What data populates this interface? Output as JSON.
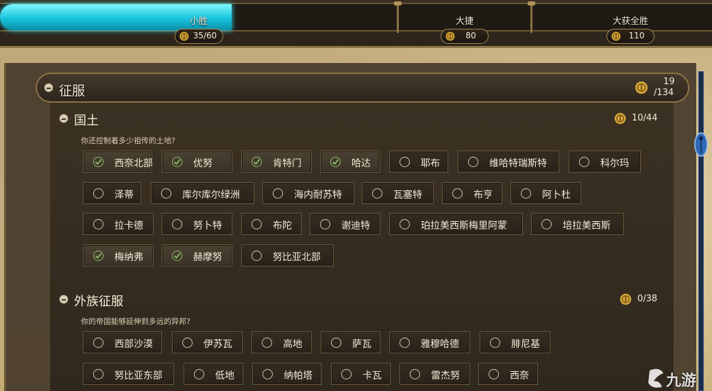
{
  "progress": {
    "value_fraction": 0.325,
    "tiers": [
      {
        "label": "小胜",
        "badge": "35/60"
      },
      {
        "label": "大捷",
        "badge": "80"
      },
      {
        "label": "大获全胜",
        "badge": "110"
      }
    ]
  },
  "conquest": {
    "title": "征服",
    "count_top": "19",
    "count_bottom": "/134"
  },
  "territory": {
    "title": "国土",
    "desc": "你还控制着多少祖传的土地?",
    "count": "10/44",
    "items": [
      {
        "label": "西奈北部",
        "checked": true
      },
      {
        "label": "优努",
        "checked": true
      },
      {
        "label": "肯特门",
        "checked": true
      },
      {
        "label": "哈达",
        "checked": true
      },
      {
        "label": "耶布",
        "checked": false
      },
      {
        "label": "维哈特瑞斯特",
        "checked": false
      },
      {
        "label": "科尔玛",
        "checked": false
      },
      {
        "label": "泽蒂",
        "checked": false
      },
      {
        "label": "库尔库尔绿洲",
        "checked": false
      },
      {
        "label": "海内耐苏特",
        "checked": false
      },
      {
        "label": "瓦塞特",
        "checked": false
      },
      {
        "label": "布亨",
        "checked": false
      },
      {
        "label": "阿卜杜",
        "checked": false
      },
      {
        "label": "拉卡德",
        "checked": false
      },
      {
        "label": "努卜特",
        "checked": false
      },
      {
        "label": "布陀",
        "checked": false
      },
      {
        "label": "谢迪特",
        "checked": false
      },
      {
        "label": "珀拉美西斯梅里阿蒙",
        "checked": false
      },
      {
        "label": "培拉美西斯",
        "checked": false
      },
      {
        "label": "梅纳弗",
        "checked": true
      },
      {
        "label": "赫摩努",
        "checked": true
      },
      {
        "label": "努比亚北部",
        "checked": false
      }
    ]
  },
  "foreign": {
    "title": "外族征服",
    "desc": "你的帝国能够延伸到多远的异邦?",
    "count": "0/38",
    "items": [
      {
        "label": "西部沙漠",
        "checked": false
      },
      {
        "label": "伊苏瓦",
        "checked": false
      },
      {
        "label": "高地",
        "checked": false
      },
      {
        "label": "萨瓦",
        "checked": false
      },
      {
        "label": "雅穆哈德",
        "checked": false
      },
      {
        "label": "腓尼基",
        "checked": false
      },
      {
        "label": "努比亚东部",
        "checked": false
      },
      {
        "label": "低地",
        "checked": false
      },
      {
        "label": "纳帕塔",
        "checked": false
      },
      {
        "label": "卡瓦",
        "checked": false
      },
      {
        "label": "雷杰努",
        "checked": false
      },
      {
        "label": "西奈",
        "checked": false
      }
    ]
  },
  "watermark": {
    "text": "九游"
  },
  "colors": {
    "accent": "#19c4dd",
    "check": "#8fc06a",
    "gold": "#d6a83a"
  }
}
